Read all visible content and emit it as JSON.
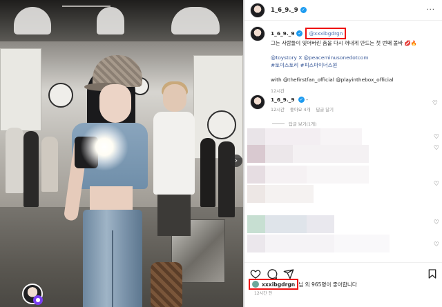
{
  "post": {
    "username": "1_6_9._9",
    "more_label": "···"
  },
  "caption": {
    "username": "1_6_9._9",
    "mention": "@xxxibgdrgn",
    "text": "그는 사람들이 잊어버린 춤을 다시 꺼내게 만드는 첫 번째 볼바 💋🔥",
    "link_line": "@toystory X @peaceminusonedotcom",
    "tags": "#토이스토리 #피스마이너스원",
    "with_line": "with @thefirstfan_official @playinthebox_official",
    "time": "12시간"
  },
  "comment": {
    "username": "1_6_9._9",
    "text": "-",
    "time": "12시간",
    "likes": "좋아요 4개",
    "reply": "답글 달기",
    "view_replies": "답글 보기(1개)"
  },
  "footer": {
    "liker": "xxxibgdrgn",
    "likes_suffix": "님 외 965명이 좋아합니다",
    "post_time": "12시간 전"
  },
  "colors": {
    "highlight_box": "#e11111",
    "link": "#385898",
    "verified": "#1d9bf0"
  },
  "icons": [
    "verified-icon",
    "heart-icon",
    "comment-icon",
    "share-icon",
    "bookmark-icon",
    "chevron-right-icon",
    "more-icon"
  ]
}
